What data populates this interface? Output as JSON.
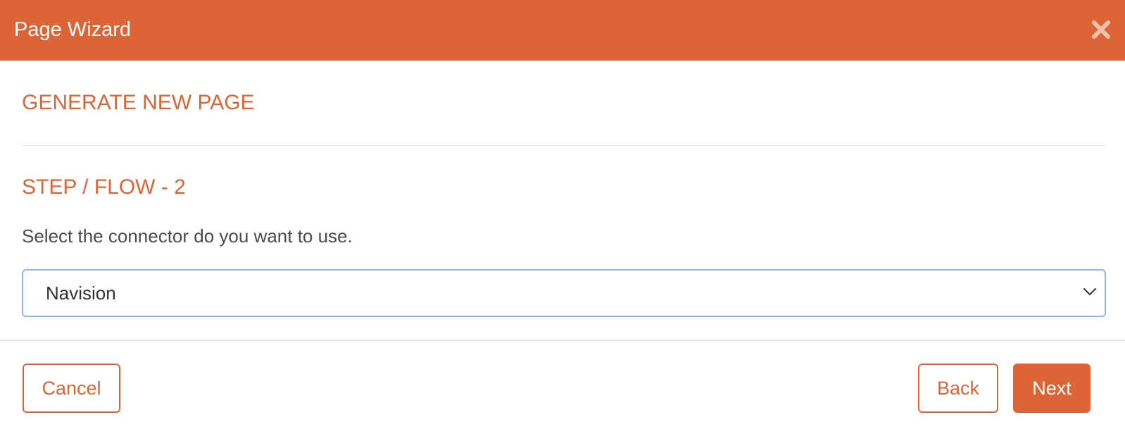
{
  "header": {
    "title": "Page Wizard",
    "close_icon": "close-icon"
  },
  "body": {
    "heading": "GENERATE NEW PAGE",
    "step_title": "STEP / FLOW - 2",
    "instruction": "Select the connector do you want to use.",
    "connector_select": {
      "selected": "Navision",
      "icon": "chevron-down-icon"
    }
  },
  "footer": {
    "cancel_label": "Cancel",
    "back_label": "Back",
    "next_label": "Next"
  },
  "colors": {
    "accent": "#dc6436",
    "select_border": "#8db8ef",
    "text": "#4a4a4a"
  }
}
